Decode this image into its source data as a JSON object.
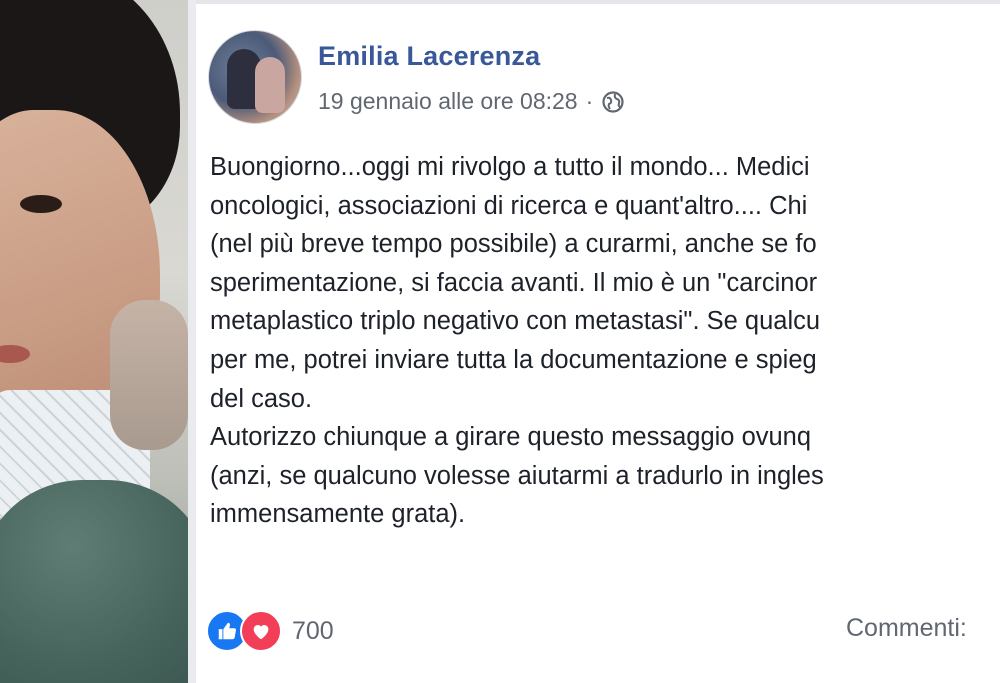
{
  "post": {
    "author": "Emilia Lacerenza",
    "date": "19 gennaio alle ore 08:28",
    "separator": "·",
    "privacy_icon": "globe-icon",
    "lines": [
      "Buongiorno...oggi mi rivolgo a tutto il mondo... Medici",
      "oncologici, associazioni di ricerca e quant'altro.... Chi",
      "(nel più breve tempo possibile) a curarmi, anche se fo",
      "sperimentazione, si faccia avanti. Il mio è un \"carcinor",
      "metaplastico triplo negativo con metastasi\". Se qualcu",
      "per me, potrei inviare tutta la documentazione e spieg",
      "del caso.",
      "Autorizzo chiunque a girare questo messaggio ovunq",
      "(anzi, se qualcuno volesse aiutarmi a tradurlo in ingles",
      "immensamente grata)."
    ],
    "reactions": {
      "icons": [
        "like-icon",
        "love-icon"
      ],
      "count": "700"
    },
    "comments_label": "Commenti:"
  },
  "colors": {
    "author": "#385898",
    "like": "#1877f2",
    "love": "#f33e58",
    "meta": "#616770",
    "text": "#1d2129"
  }
}
